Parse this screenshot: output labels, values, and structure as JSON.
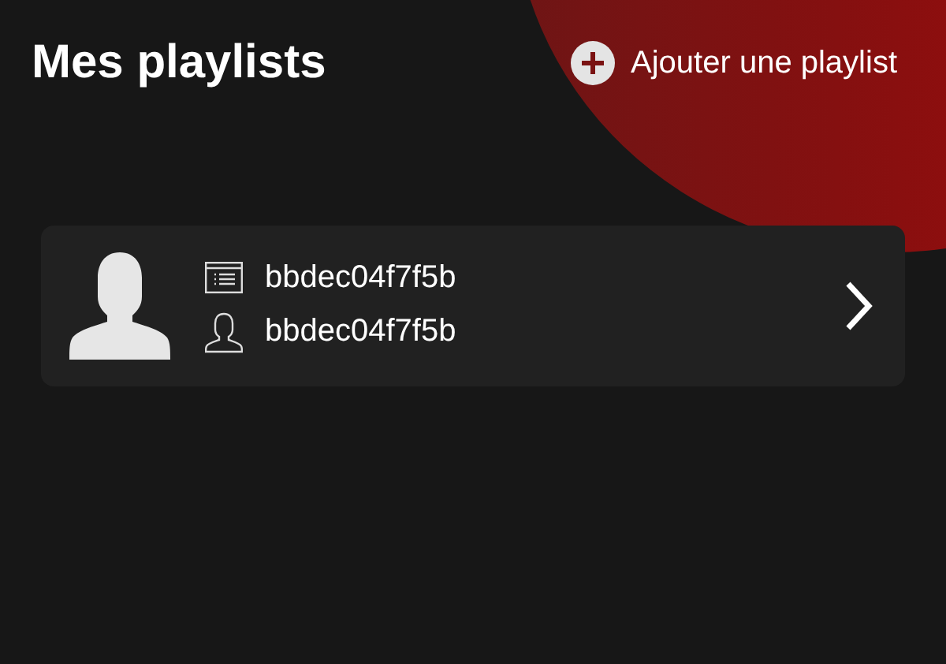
{
  "header": {
    "title": "Mes playlists",
    "add_button": "Ajouter une playlist"
  },
  "playlists": [
    {
      "name": "bbdec04f7f5b",
      "owner": "bbdec04f7f5b"
    }
  ]
}
